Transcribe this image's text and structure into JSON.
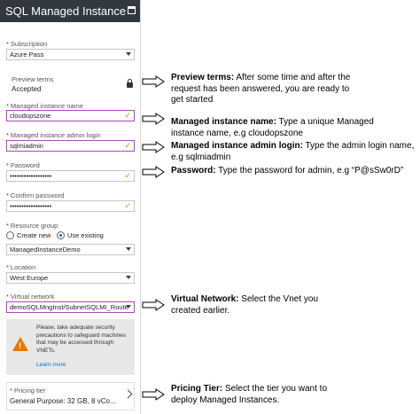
{
  "window": {
    "title": "SQL Managed Instance"
  },
  "form": {
    "subscription": {
      "label": "Subscription",
      "value": "Azure Pass"
    },
    "preview_terms": {
      "label": "Preview terms",
      "value": "Accepted"
    },
    "instance_name": {
      "label": "Managed instance name",
      "value": "cloudopszone"
    },
    "admin_login": {
      "label": "Managed instance admin login",
      "value": "sqlmiadmin"
    },
    "password": {
      "label": "Password",
      "value": "••••••••••••••••••"
    },
    "confirm_password": {
      "label": "Confirm password",
      "value": "••••••••••••••••••"
    },
    "resource_group": {
      "label": "Resource group",
      "create_new": "Create new",
      "use_existing": "Use existing",
      "value": "ManagedInstanceDemo"
    },
    "location": {
      "label": "Location",
      "value": "West Europe"
    },
    "virtual_network": {
      "label": "Virtual network",
      "value": "demoSQLMngInst/SubnetSQLMI_Route"
    },
    "warning": {
      "text": "Please, take adequate security precautions to safeguard machines that may be accessed through VNETs.",
      "link": "Learn more"
    },
    "pricing_tier": {
      "label": "Pricing tier",
      "value": "General Purpose: 32 GB, 8 vCo..."
    }
  },
  "notes": [
    {
      "title": "Preview terms:",
      "text": " After some time and after the request has been answered, you are ready to get started"
    },
    {
      "title": "Managed instance name:",
      "text": " Type a unique Managed instance name, e.g cloudopszone"
    },
    {
      "title": "Managed instance admin login:",
      "text": " Type the admin login name, e.g sqlmiadmin"
    },
    {
      "title": "Password:",
      "text": "  Type the password for admin, e.g “P@sSw0rD”"
    },
    {
      "title": "Virtual Network:",
      "text": " Select the Vnet you created earlier."
    },
    {
      "title": "Pricing Tier:",
      "text": " Select the tier you want to deploy Managed Instances."
    }
  ],
  "colors": {
    "titlebar": "#32383f",
    "valid_border": "#aa47bc",
    "check": "#7fba00",
    "required": "#c8102e",
    "warning": "#e57a00",
    "link": "#0072c6"
  }
}
